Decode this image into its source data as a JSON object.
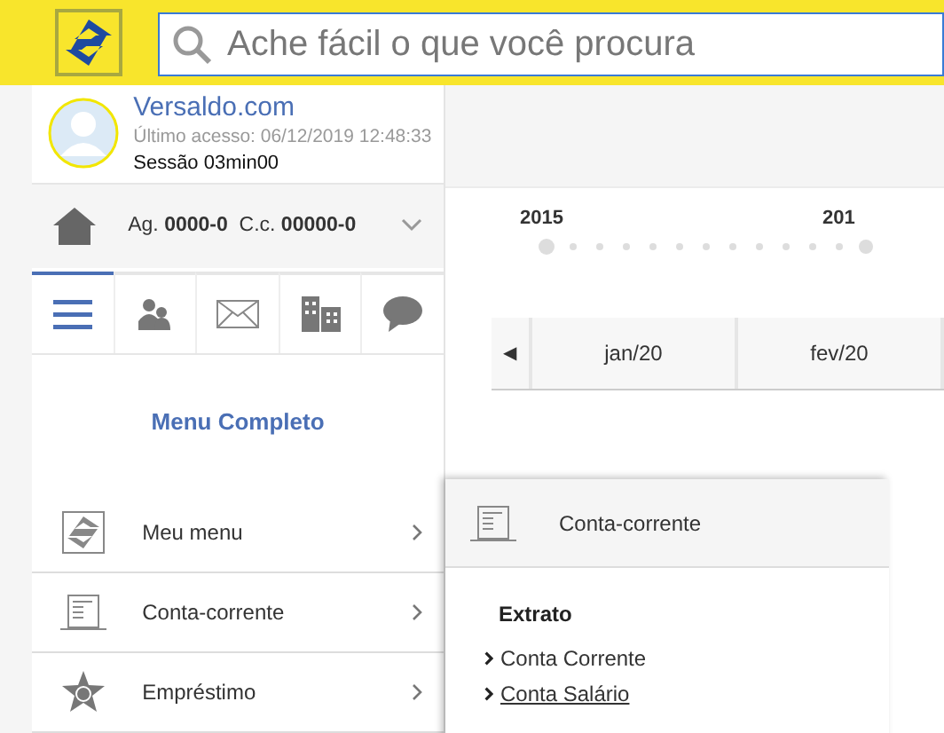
{
  "header": {
    "search": {
      "placeholder": "Ache fácil o que você procura"
    }
  },
  "user": {
    "name": "Versaldo.com",
    "last_access": "Último acesso: 06/12/2019 12:48:33",
    "session": "Sessão 03min00"
  },
  "account": {
    "agency_label": "Ag.",
    "agency": "0000-0",
    "account_label": "C.c.",
    "account": "00000-0"
  },
  "tabs": [
    {
      "kind": "menu",
      "selected": true
    },
    {
      "kind": "people",
      "selected": false
    },
    {
      "kind": "mail",
      "selected": false
    },
    {
      "kind": "building",
      "selected": false
    },
    {
      "kind": "chat",
      "selected": false
    }
  ],
  "menu_title": "Menu Completo",
  "menu_items": [
    {
      "kind": "logo",
      "label": "Meu menu"
    },
    {
      "kind": "statement",
      "label": "Conta-corrente"
    },
    {
      "kind": "star",
      "label": "Empréstimo"
    }
  ],
  "timeline": {
    "years": [
      "2015",
      "201"
    ]
  },
  "months": {
    "prev": "◀",
    "items": [
      "jan/20",
      "fev/20"
    ]
  },
  "flyout": {
    "title": "Conta-corrente",
    "section": "Extrato",
    "links": [
      {
        "label": "Conta Corrente",
        "underlined": false
      },
      {
        "label": "Conta Salário",
        "underlined": true
      }
    ]
  }
}
